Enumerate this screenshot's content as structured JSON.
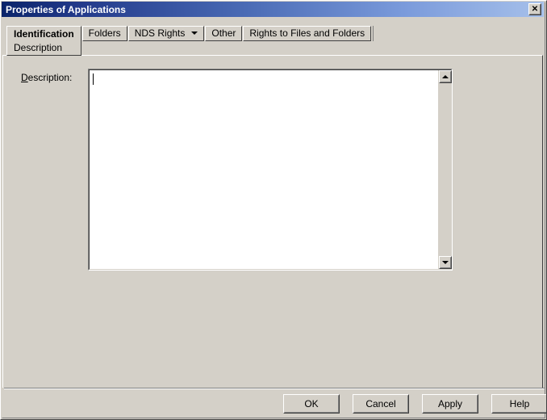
{
  "window": {
    "title": "Properties of Applications",
    "close_icon": "close-icon",
    "close_glyph": "✕"
  },
  "tabs": [
    {
      "label": "Identification",
      "sub_label": "Description",
      "active": true,
      "has_dropdown": false
    },
    {
      "label": "Folders",
      "active": false,
      "has_dropdown": false
    },
    {
      "label": "NDS Rights",
      "active": false,
      "has_dropdown": true,
      "dropdown_icon": "chevron-down-icon"
    },
    {
      "label": "Other",
      "active": false,
      "has_dropdown": false
    },
    {
      "label": "Rights to Files and Folders",
      "active": false,
      "has_dropdown": false
    }
  ],
  "form": {
    "description": {
      "label_prefix": "",
      "label_accelerator": "D",
      "label_suffix": "escription:",
      "value": "",
      "placeholder": ""
    }
  },
  "scrollbar": {
    "up_icon": "arrow-up-icon",
    "down_icon": "arrow-down-icon"
  },
  "footer": {
    "buttons": [
      {
        "label": "OK",
        "name": "ok-button"
      },
      {
        "label": "Cancel",
        "name": "cancel-button"
      },
      {
        "label": "Apply",
        "name": "apply-button"
      },
      {
        "label": "Help",
        "name": "help-button"
      }
    ]
  },
  "colors": {
    "face": "#d4d0c8",
    "title_start": "#0a246a",
    "title_end": "#a6c0ea",
    "field_bg": "#ffffff",
    "text": "#000000"
  }
}
